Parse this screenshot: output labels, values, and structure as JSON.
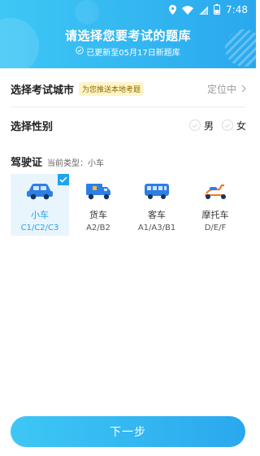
{
  "status_bar": {
    "time": "7:48"
  },
  "header": {
    "title": "请选择您要考试的题库",
    "subtitle": "已更新至05月17日新题库"
  },
  "city_row": {
    "label": "选择考试城市",
    "tag": "为您推送本地考题",
    "value": "定位中"
  },
  "gender_row": {
    "label": "选择性别",
    "options": [
      "男",
      "女"
    ]
  },
  "license": {
    "title": "驾驶证",
    "current": "当前类型：小车",
    "types": [
      {
        "name": "小车",
        "code": "C1/C2/C3",
        "icon": "car-icon",
        "selected": true
      },
      {
        "name": "货车",
        "code": "A2/B2",
        "icon": "truck-icon",
        "selected": false
      },
      {
        "name": "客车",
        "code": "A1/A3/B1",
        "icon": "bus-icon",
        "selected": false
      },
      {
        "name": "摩托车",
        "code": "D/E/F",
        "icon": "scooter-icon",
        "selected": false
      }
    ]
  },
  "next_button": {
    "label": "下一步"
  },
  "colors": {
    "accent": "#22a3ee",
    "header_start": "#3ec7f5",
    "header_end": "#2aa8ee",
    "scooter": "#f07a2a"
  }
}
